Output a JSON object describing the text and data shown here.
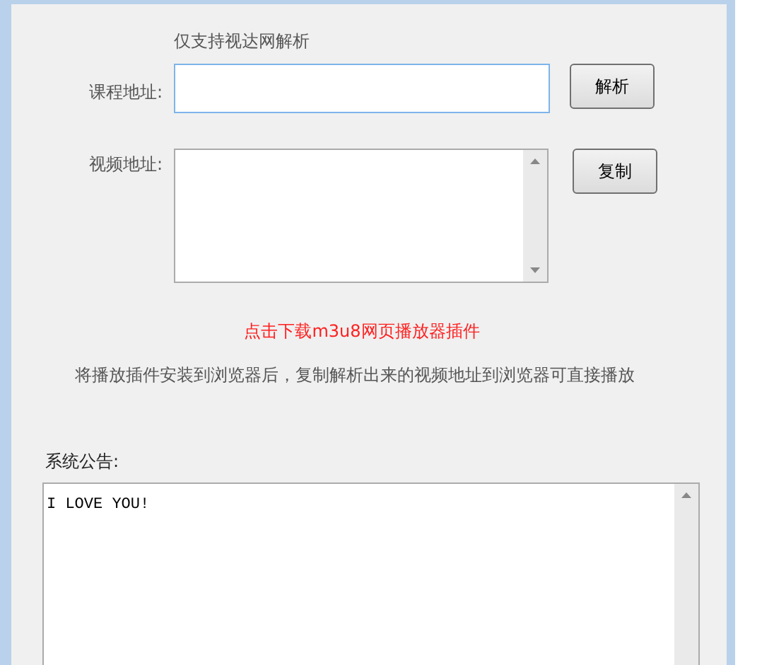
{
  "hint": "仅支持视达网解析",
  "course": {
    "label": "课程地址:",
    "button": "解析"
  },
  "video": {
    "label": "视频地址:",
    "button": "复制"
  },
  "download_link": "点击下载m3u8网页播放器插件",
  "info": "将播放插件安装到浏览器后，复制解析出来的视频地址到浏览器可直接播放",
  "notice": {
    "label": "系统公告:",
    "value": "I LOVE YOU!"
  }
}
